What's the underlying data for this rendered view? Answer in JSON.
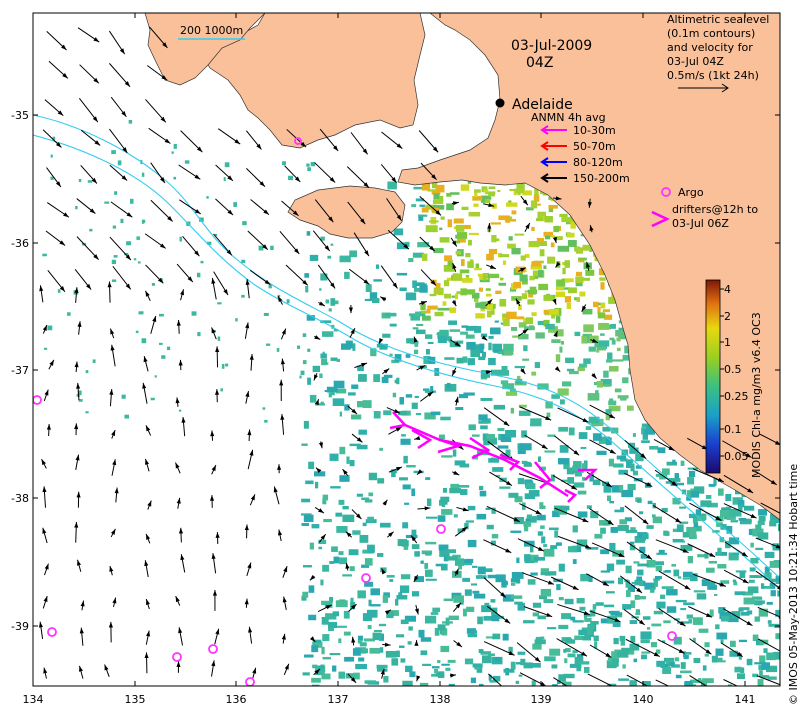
{
  "map": {
    "date": "03-Jul-2009",
    "time": "04Z",
    "city": "Adelaide",
    "scale_label": "200  1000m",
    "legend_title": [
      "Altimetric sealevel",
      "(0.1m contours)",
      "and velocity for",
      "03-Jul 04Z",
      "0.5m/s (1kt 24h)"
    ],
    "anmn": {
      "title": "ANMN 4h avg",
      "items": [
        {
          "label": "10-30m",
          "color": "#ff00ff"
        },
        {
          "label": "50-70m",
          "color": "#ff0000"
        },
        {
          "label": "80-120m",
          "color": "#0000ff"
        },
        {
          "label": "150-200m",
          "color": "#000000"
        }
      ]
    },
    "argo": {
      "label": "Argo",
      "drifters": [
        "drifters@12h to",
        "03-Jul 06Z"
      ],
      "color": "#ff33ff"
    },
    "colorbar": {
      "label": "MODIS Chl-a mg/m3 v6.4 OC3",
      "ticks": [
        "4",
        "2",
        "1",
        "0.5",
        "0.25",
        "0.1",
        "0.05"
      ],
      "scale": "log"
    },
    "axes": {
      "x_ticks": [
        "134",
        "135",
        "136",
        "137",
        "138",
        "139",
        "140",
        "141"
      ],
      "y_ticks": [
        "-35",
        "-36",
        "-37",
        "-38",
        "-39"
      ],
      "lon_range": [
        134.0,
        141.35
      ],
      "lat_range": [
        -39.5,
        -34.3
      ]
    },
    "credit": "© IMOS 05-May-2013 10:21:34 Hobart time",
    "colors": {
      "land": "#f9c09a",
      "contour": "#33ccee",
      "argo": "#ff33ff",
      "drifter": "#ff00ff"
    }
  }
}
